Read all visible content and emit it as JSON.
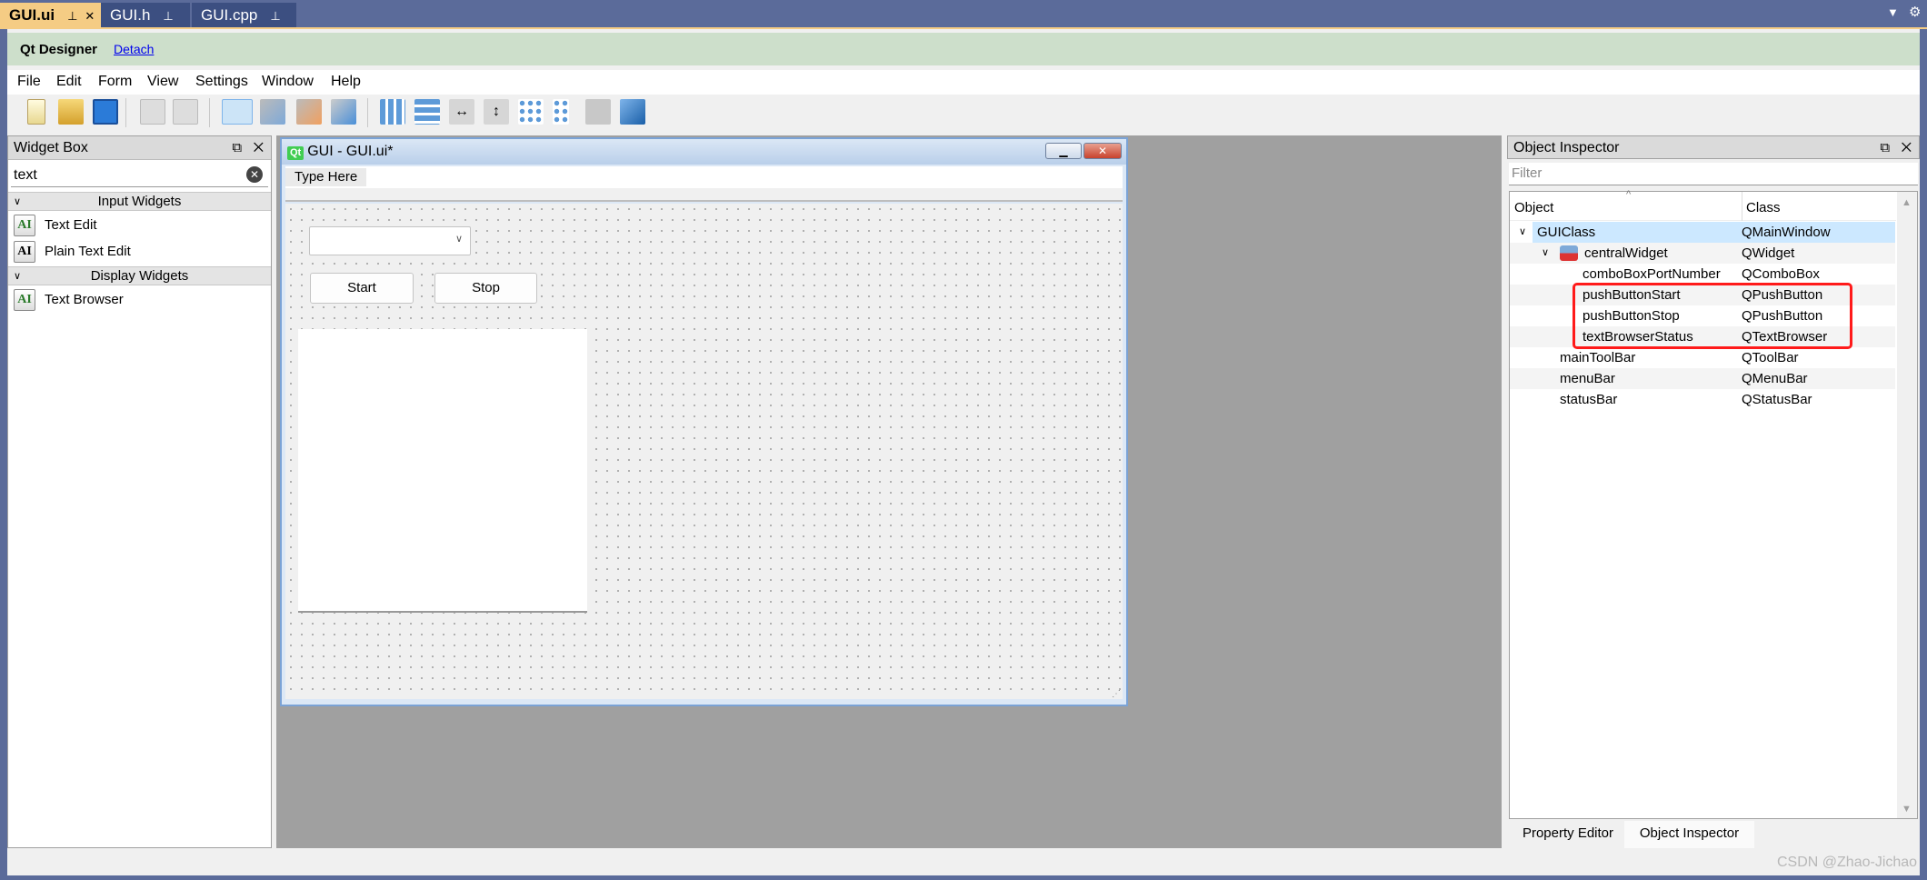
{
  "tabs": [
    {
      "label": "GUI.ui",
      "active": true
    },
    {
      "label": "GUI.h"
    },
    {
      "label": "GUI.cpp"
    }
  ],
  "designer": {
    "title": "Qt Designer",
    "detach": "Detach"
  },
  "menu": [
    "File",
    "Edit",
    "Form",
    "View",
    "Settings",
    "Window",
    "Help"
  ],
  "toolbar_icons": [
    "new-file-icon",
    "open-folder-icon",
    "save-icon",
    "send-to-back-icon",
    "bring-to-front-icon",
    "edit-widgets-icon",
    "edit-signals-slots-icon",
    "edit-buddies-icon",
    "edit-tab-order-icon",
    "layout-horizontal-icon",
    "layout-vertical-icon",
    "layout-horizontal-splitter-icon",
    "layout-vertical-splitter-icon",
    "layout-grid-icon",
    "layout-form-icon",
    "break-layout-icon",
    "adjust-size-icon"
  ],
  "widget_box": {
    "title": "Widget Box",
    "search": "text",
    "categories": [
      {
        "label": "Input Widgets",
        "items": [
          "Text Edit",
          "Plain Text Edit"
        ]
      },
      {
        "label": "Display Widgets",
        "items": [
          "Text Browser"
        ]
      }
    ]
  },
  "form": {
    "title": "GUI - GUI.ui*",
    "menu_placeholder": "Type Here",
    "combo_value": "",
    "start": "Start",
    "stop": "Stop"
  },
  "object_inspector": {
    "title": "Object Inspector",
    "filter_placeholder": "Filter",
    "col_object": "Object",
    "col_class": "Class",
    "rows": [
      {
        "object": "GUIClass",
        "class": "QMainWindow"
      },
      {
        "object": "centralWidget",
        "class": "QWidget"
      },
      {
        "object": "comboBoxPortNumber",
        "class": "QComboBox"
      },
      {
        "object": "pushButtonStart",
        "class": "QPushButton"
      },
      {
        "object": "pushButtonStop",
        "class": "QPushButton"
      },
      {
        "object": "textBrowserStatus",
        "class": "QTextBrowser"
      },
      {
        "object": "mainToolBar",
        "class": "QToolBar"
      },
      {
        "object": "menuBar",
        "class": "QMenuBar"
      },
      {
        "object": "statusBar",
        "class": "QStatusBar"
      }
    ]
  },
  "bottom_tabs": [
    "Property Editor",
    "Object Inspector"
  ],
  "watermark": "CSDN @Zhao-Jichao",
  "colors": {
    "frame": "#5b6b9a",
    "active_tab": "#f5cc84",
    "designer_bar": "#cddfcb",
    "selection": "#cce8ff",
    "highlight_box": "#ff1a1a"
  }
}
